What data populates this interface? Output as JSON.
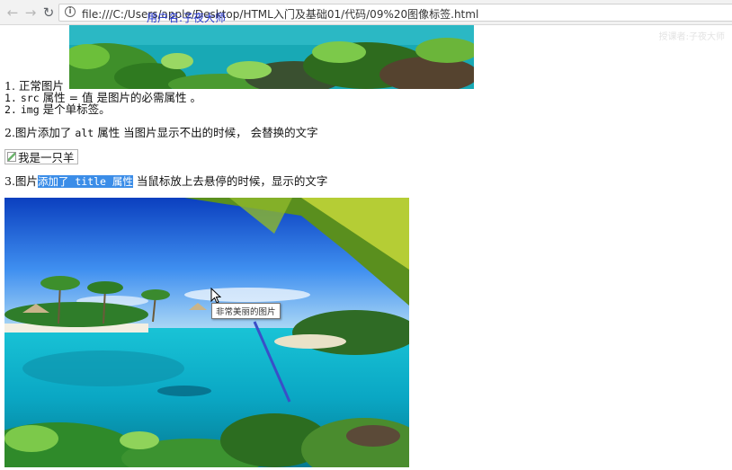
{
  "browser": {
    "url": "file:///C:/Users/apple/Desktop/HTML入门及基础01/代码/09%20图像标签.html",
    "overlay_text": "用户名:子夜大师",
    "watermark": "授课者:子夜大师"
  },
  "content": {
    "line1_prefix": "1. 正常图片",
    "line2_num": "1.",
    "line2_code": "src",
    "line2_text": "属性 = 值 是图片的必需属性 。",
    "line3_num": "2.",
    "line3_code": "img",
    "line3_text": "是个单标签。",
    "line4_prefix": "2.图片添加了",
    "line4_code": "alt",
    "line4_suffix": "属性 当图片显示不出的时候， 会替换的文字",
    "alt_text": "我是一只羊",
    "line5_prefix": "3.图片",
    "line5_selected": "添加了 title 属性",
    "line5_suffix": "当鼠标放上去悬停的时候，显示的文字",
    "tooltip": "非常美丽的图片"
  },
  "colors": {
    "selection": "#3b8de8",
    "overlay_text": "#2a3bd0",
    "annotation_arrow": "#3a4fc8"
  },
  "icons": [
    "back-arrow-icon",
    "forward-arrow-icon",
    "reload-icon",
    "info-icon",
    "broken-image-icon",
    "mouse-cursor-icon"
  ]
}
